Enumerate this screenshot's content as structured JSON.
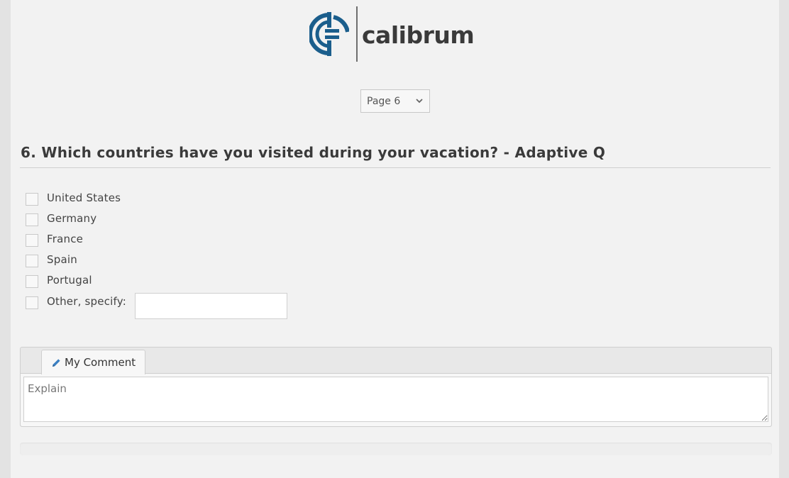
{
  "logo": {
    "text": "calibrum",
    "mark_color": "#1b5e8c"
  },
  "page_select": {
    "value": "Page 6"
  },
  "question": {
    "title": "6. Which countries have you visited during your vacation? - Adaptive Q",
    "options": [
      {
        "label": "United States",
        "checked": false
      },
      {
        "label": "Germany",
        "checked": false
      },
      {
        "label": "France",
        "checked": false
      },
      {
        "label": "Spain",
        "checked": false
      },
      {
        "label": "Portugal",
        "checked": false
      },
      {
        "label": "Other, specify:",
        "checked": false
      }
    ],
    "other_value": ""
  },
  "comment": {
    "tab_label": "My Comment",
    "placeholder": "Explain",
    "value": ""
  },
  "progress": {
    "fraction": 0.0
  },
  "colors": {
    "accent": "#1b5e8c",
    "pencil": "#3a7fc1"
  }
}
